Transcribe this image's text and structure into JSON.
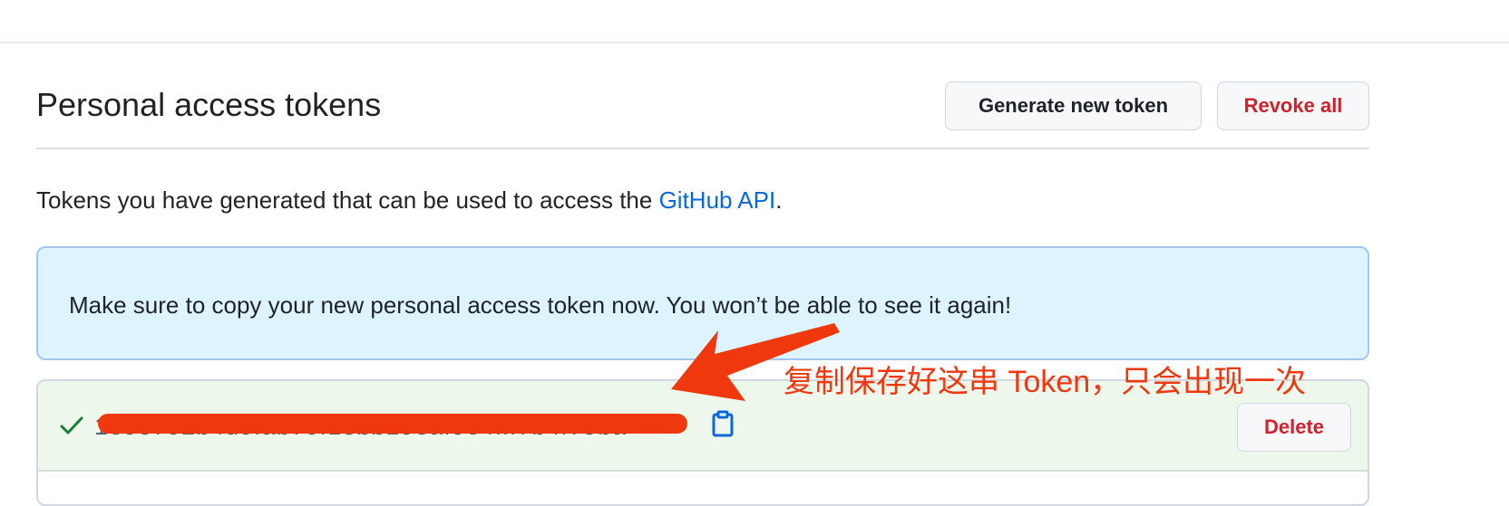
{
  "header": {
    "title": "Personal access tokens",
    "generate_label": "Generate new token",
    "revoke_label": "Revoke all"
  },
  "description": {
    "text_before": "Tokens you have generated that can be used to access the ",
    "link_text": "GitHub API",
    "text_after": "."
  },
  "flash": {
    "message": "Make sure to copy your new personal access token now. You won’t be able to see it again!"
  },
  "token": {
    "value": "1e9e792b4d9fab79f13bb19eaf9e4fff7b4f79ba",
    "delete_label": "Delete",
    "status_icon": "check-icon",
    "copy_icon": "clipboard-icon"
  },
  "annotation": {
    "text": "复制保存好这串 Token，只会出现一次",
    "color": "#f0380f"
  },
  "colors": {
    "link": "#0969da",
    "danger": "#cf222e",
    "flash_bg": "#ddf4ff",
    "success_bg": "#eef7ec",
    "check": "#1a7f37"
  }
}
